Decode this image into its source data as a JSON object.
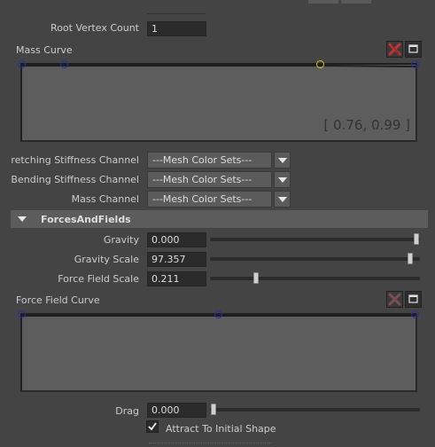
{
  "root_vertex_count": {
    "label": "Root Vertex Count",
    "value": "1"
  },
  "mass_curve": {
    "label": "Mass Curve",
    "readout": "[ 0.76, 0.99 ]",
    "icons": [
      "delete-key-icon",
      "expand-graph-icon"
    ]
  },
  "channels": [
    {
      "label": "retching Stiffness Channel",
      "value": "---Mesh Color Sets---"
    },
    {
      "label": "Bending Stiffness Channel",
      "value": "---Mesh Color Sets---"
    },
    {
      "label": "Mass Channel",
      "value": "---Mesh Color Sets---"
    }
  ],
  "section": {
    "title": "ForcesAndFields",
    "expanded": true
  },
  "sliders": {
    "gravity": {
      "label": "Gravity",
      "value": "0.000",
      "level": 1.0
    },
    "gravity_scale": {
      "label": "Gravity Scale",
      "value": "97.357",
      "level": 0.97
    },
    "force_field_scale": {
      "label": "Force Field Scale",
      "value": "0.211",
      "level": 0.21
    },
    "drag": {
      "label": "Drag",
      "value": "0.000",
      "level": 0.0
    }
  },
  "force_field_curve": {
    "label": "Force Field Curve"
  },
  "attract": {
    "label": "Attract To Initial Shape",
    "checked": true
  },
  "colors": {
    "bg": "#444444",
    "graph": "#5d5d5d",
    "field": "#2b2b2b",
    "handle": "#2b2bb0",
    "selected_handle": "#d6c21b",
    "delete_icon": "#c83232"
  }
}
